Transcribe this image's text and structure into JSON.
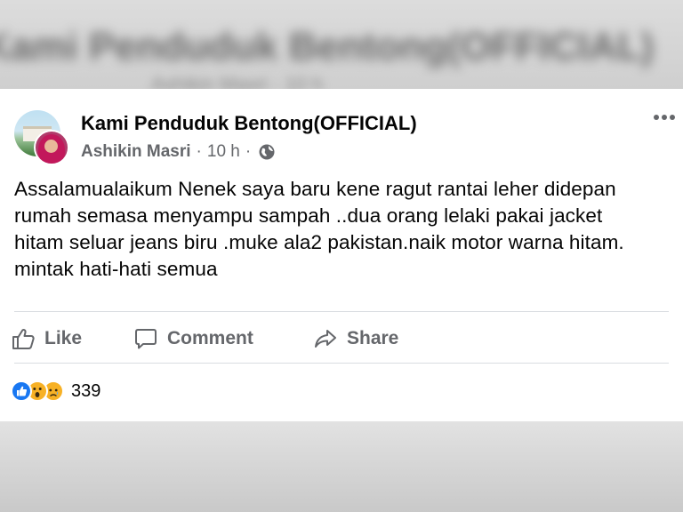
{
  "background": {
    "blurred_title": "Kami Penduduk Bentong(OFFICIAL)",
    "blurred_sub": "Ashikin Masri · 10 h"
  },
  "post": {
    "group_name": "Kami Penduduk Bentong(OFFICIAL)",
    "author": "Ashikin Masri",
    "separator": "·",
    "time": "10 h",
    "separator2": "·",
    "privacy_icon": "globe-icon",
    "more_icon": "more-options-icon",
    "text": "Assalamualaikum Nenek saya baru kene ragut rantai leher didepan rumah semasa menyampu sampah ..dua orang lelaki pakai jacket hitam seluar jeans biru .muke ala2 pakistan.naik motor warna hitam. mintak hati-hati semua"
  },
  "actions": {
    "like_label": "Like",
    "comment_label": "Comment",
    "share_label": "Share"
  },
  "reactions": {
    "icons": [
      "like-reaction-icon",
      "wow-reaction-icon",
      "sad-reaction-icon"
    ],
    "count": "339"
  },
  "colors": {
    "like_blue": "#1877f2",
    "emoji_yellow": "#f7b125",
    "secondary_text": "#65676b",
    "primary_text": "#050505"
  }
}
